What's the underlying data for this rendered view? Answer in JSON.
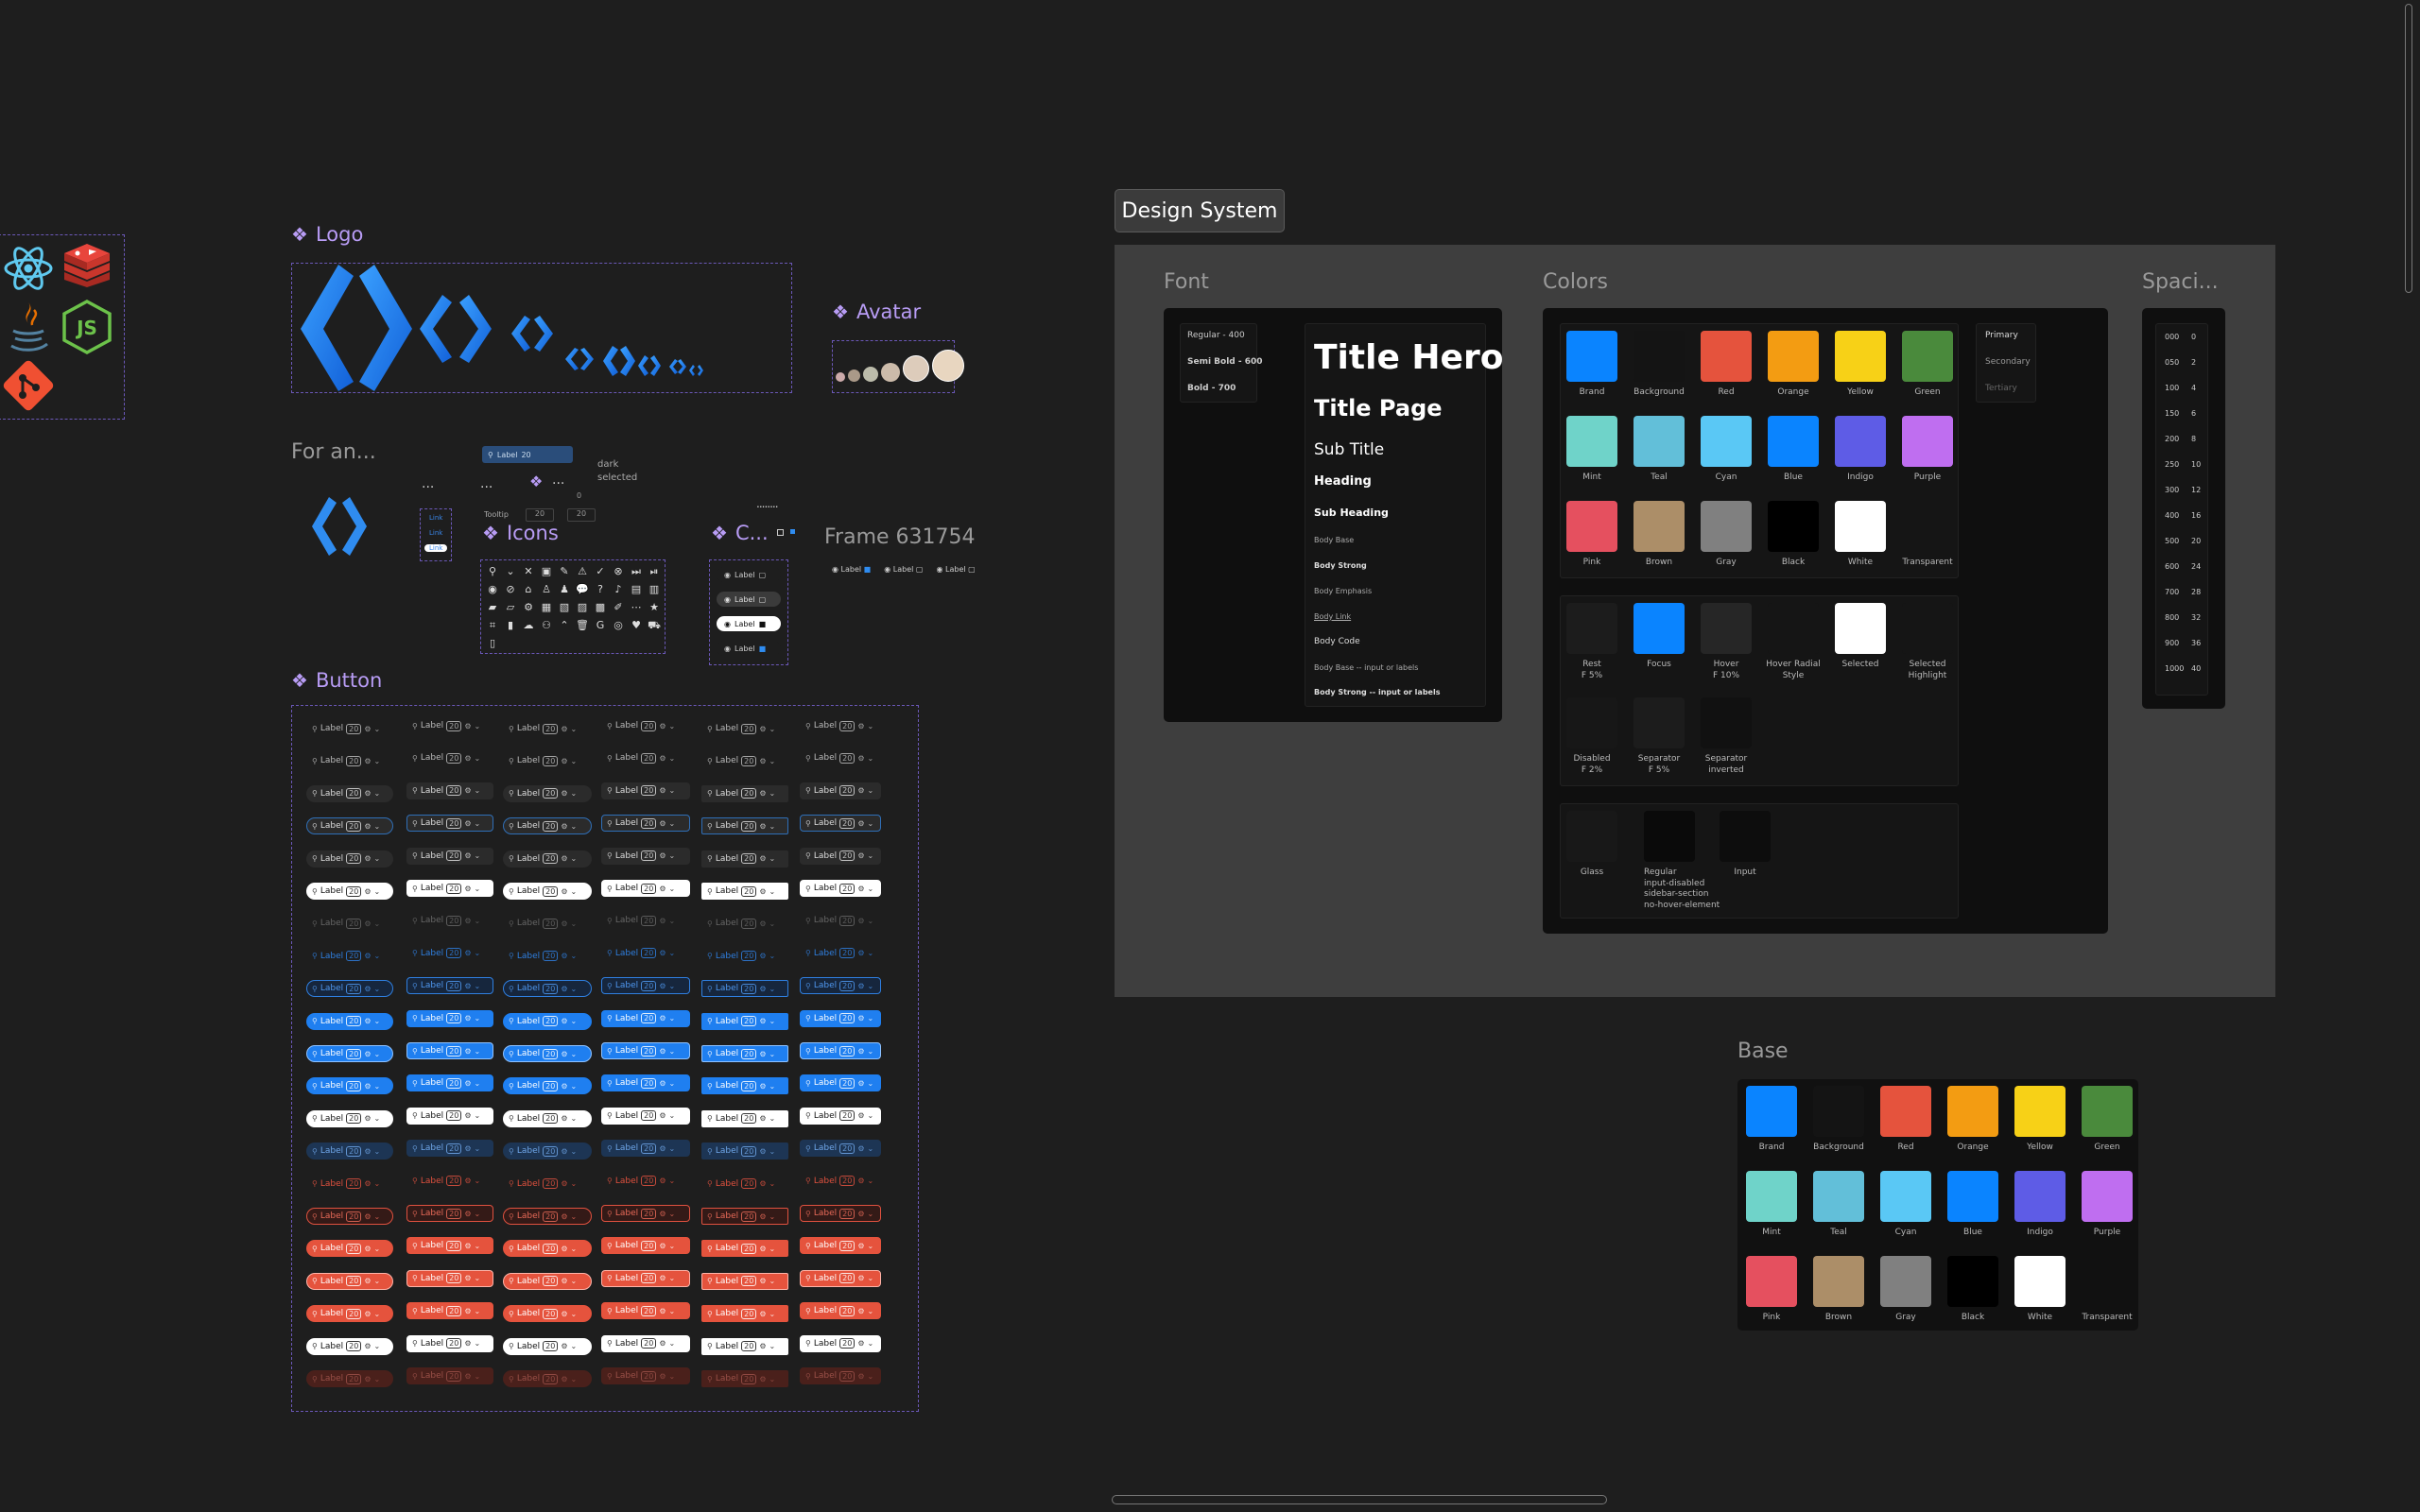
{
  "canvas": {
    "logo_title": "Logo",
    "avatar_title": "Avatar",
    "for_an_title": "For an...",
    "icons_title": "Icons",
    "c_title": "C...",
    "frame_title": "Frame 631754",
    "button_title": "Button",
    "dots_1": "...",
    "dots_2": "...",
    "dots_3": "...",
    "dots_4": "........",
    "variant_tag_dark": "dark",
    "variant_tag_selected": "selected",
    "tooltip_label": "Tooltip",
    "tooltip_value_a": "20",
    "tooltip_value_b": "20",
    "zero": "0",
    "search_pill_label": "Label",
    "search_pill_count": "20",
    "link_samples": [
      "Link",
      "Link",
      "Link"
    ],
    "c_chips": [
      "Label",
      "Label",
      "Label",
      "Label"
    ],
    "frame_chips": [
      "Label",
      "Label",
      "Label"
    ]
  },
  "buttons": {
    "label": "Label",
    "count": "20",
    "rows": [
      {
        "variant": "ghost-gray"
      },
      {
        "variant": "ghost-gray"
      },
      {
        "variant": "dark"
      },
      {
        "variant": "dark-outline-blue"
      },
      {
        "variant": "dark"
      },
      {
        "variant": "white"
      },
      {
        "variant": "faded"
      },
      {
        "variant": "blue-text"
      },
      {
        "variant": "blue-outline"
      },
      {
        "variant": "blue"
      },
      {
        "variant": "blue-selected"
      },
      {
        "variant": "blue"
      },
      {
        "variant": "white"
      },
      {
        "variant": "blue-dark"
      },
      {
        "variant": "red-text"
      },
      {
        "variant": "red-outline"
      },
      {
        "variant": "red"
      },
      {
        "variant": "red-selected"
      },
      {
        "variant": "red"
      },
      {
        "variant": "white"
      },
      {
        "variant": "red-dark"
      }
    ]
  },
  "design_system": {
    "badge": "Design System",
    "font_title": "Font",
    "colors_title": "Colors",
    "spacing_title": "Spaci...",
    "font_weights": [
      "Regular - 400",
      "Semi Bold - 600",
      "Bold - 700"
    ],
    "font_samples": [
      "Title Hero",
      "Title Page",
      "Sub Title",
      "Heading",
      "Sub Heading",
      "Body Base",
      "Body Strong",
      "Body Emphasis",
      "Body Link",
      "Body  Code",
      "Body Base -- input or labels",
      "Body Strong -- input or labels"
    ],
    "color_swatches": [
      {
        "name": "Brand",
        "hex": "#0a84ff"
      },
      {
        "name": "Background",
        "hex": "#141414"
      },
      {
        "name": "Red",
        "hex": "#e5533d"
      },
      {
        "name": "Orange",
        "hex": "#f39c12"
      },
      {
        "name": "Yellow",
        "hex": "#f7d117"
      },
      {
        "name": "Green",
        "hex": "#4a8a3c"
      },
      {
        "name": "Mint",
        "hex": "#6fd3c9"
      },
      {
        "name": "Teal",
        "hex": "#62bfd9"
      },
      {
        "name": "Cyan",
        "hex": "#5ac8f5"
      },
      {
        "name": "Blue",
        "hex": "#0a84ff"
      },
      {
        "name": "Indigo",
        "hex": "#5e5ce6"
      },
      {
        "name": "Purple",
        "hex": "#bf6ef0"
      },
      {
        "name": "Pink",
        "hex": "#e5505f"
      },
      {
        "name": "Brown",
        "hex": "#ac8e68"
      },
      {
        "name": "Gray",
        "hex": "#808080"
      },
      {
        "name": "Black",
        "hex": "#000000"
      },
      {
        "name": "White",
        "hex": "#ffffff"
      },
      {
        "name": "Transparent",
        "hex": "transparent"
      }
    ],
    "text_levels": [
      "Primary",
      "Secondary",
      "Tertiary"
    ],
    "state_swatches": [
      {
        "name": "Rest\nF 5%",
        "hex": "#1c1c1c"
      },
      {
        "name": "Focus",
        "hex": "#0a84ff"
      },
      {
        "name": "Hover\nF 10%",
        "hex": "#262626"
      },
      {
        "name": "Hover Radial\nStyle",
        "hex": "#151515"
      },
      {
        "name": "Selected",
        "hex": "#ffffff"
      },
      {
        "name": "Selected\nHighlight",
        "hex": "#151515"
      },
      {
        "name": "Disabled\nF 2%",
        "hex": "#171717"
      },
      {
        "name": "Separator\nF 5%",
        "hex": "#1c1c1c"
      },
      {
        "name": "Separator\ninverted",
        "hex": "#111111"
      }
    ],
    "surface_swatches": [
      {
        "name": "Glass",
        "hex": "#181818"
      },
      {
        "name": "Regular\ninput-disabled\nsidebar-section\nno-hover-element",
        "hex": "#0a0a0a"
      },
      {
        "name": "Input",
        "hex": "#0d0d0d"
      }
    ],
    "spacing": [
      {
        "token": "000",
        "value": "0"
      },
      {
        "token": "050",
        "value": "2"
      },
      {
        "token": "100",
        "value": "4"
      },
      {
        "token": "150",
        "value": "6"
      },
      {
        "token": "200",
        "value": "8"
      },
      {
        "token": "250",
        "value": "10"
      },
      {
        "token": "300",
        "value": "12"
      },
      {
        "token": "400",
        "value": "16"
      },
      {
        "token": "500",
        "value": "20"
      },
      {
        "token": "600",
        "value": "24"
      },
      {
        "token": "700",
        "value": "28"
      },
      {
        "token": "800",
        "value": "32"
      },
      {
        "token": "900",
        "value": "36"
      },
      {
        "token": "1000",
        "value": "40"
      }
    ]
  },
  "base": {
    "title": "Base",
    "swatches": [
      {
        "name": "Brand",
        "hex": "#0a84ff"
      },
      {
        "name": "Background",
        "hex": "#141414"
      },
      {
        "name": "Red",
        "hex": "#e5533d"
      },
      {
        "name": "Orange",
        "hex": "#f39c12"
      },
      {
        "name": "Yellow",
        "hex": "#f7d117"
      },
      {
        "name": "Green",
        "hex": "#4a8a3c"
      },
      {
        "name": "Mint",
        "hex": "#6fd3c9"
      },
      {
        "name": "Teal",
        "hex": "#62bfd9"
      },
      {
        "name": "Cyan",
        "hex": "#5ac8f5"
      },
      {
        "name": "Blue",
        "hex": "#0a84ff"
      },
      {
        "name": "Indigo",
        "hex": "#5e5ce6"
      },
      {
        "name": "Purple",
        "hex": "#bf6ef0"
      },
      {
        "name": "Pink",
        "hex": "#e5505f"
      },
      {
        "name": "Brown",
        "hex": "#ac8e68"
      },
      {
        "name": "Gray",
        "hex": "#808080"
      },
      {
        "name": "Black",
        "hex": "#000000"
      },
      {
        "name": "White",
        "hex": "#ffffff"
      },
      {
        "name": "Transparent",
        "hex": "transparent"
      }
    ]
  },
  "icons_grid": [
    "search",
    "chevron-down",
    "close",
    "image",
    "edit",
    "warning",
    "check-circle",
    "x-circle",
    "skip",
    "skip-end",
    "eye",
    "eye-off",
    "home",
    "user",
    "users",
    "chat",
    "help",
    "bell",
    "file",
    "files",
    "folder",
    "folder-open",
    "gear",
    "book",
    "doc",
    "video",
    "image-2",
    "pen",
    "more",
    "star",
    "tag",
    "bookmark",
    "cloud",
    "people",
    "chevron",
    "trash",
    "google",
    "github",
    "heart",
    "cart",
    "bin"
  ],
  "tech_icons": [
    "react-icon",
    "redis-icon",
    "java-icon",
    "nodejs-icon",
    "git-icon"
  ],
  "colors": {
    "accent": "#b89cf5",
    "brand": "#0a84ff",
    "red": "#e5533d",
    "canvas": "#1e1e1e"
  }
}
